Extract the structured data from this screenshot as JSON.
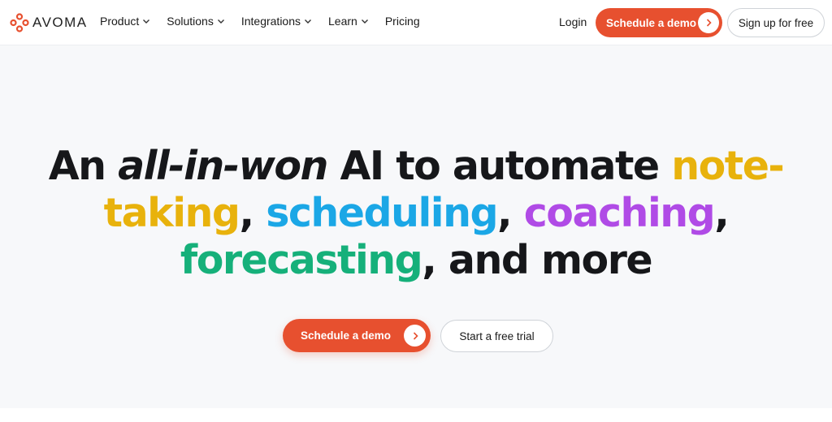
{
  "brand": {
    "name": "AVOMA",
    "accent_color": "#e7502f"
  },
  "nav": {
    "items": [
      {
        "label": "Product",
        "has_dropdown": true
      },
      {
        "label": "Solutions",
        "has_dropdown": true
      },
      {
        "label": "Integrations",
        "has_dropdown": true
      },
      {
        "label": "Learn",
        "has_dropdown": true
      },
      {
        "label": "Pricing",
        "has_dropdown": false
      }
    ],
    "login_label": "Login",
    "demo_label": "Schedule a demo",
    "signup_label": "Sign up for free"
  },
  "hero": {
    "part1": "An ",
    "part2": "all-in-won",
    "part3": " AI to automate ",
    "part4": "note-",
    "part5": "taking",
    "part6": ", ",
    "part7": "scheduling",
    "part8": ", ",
    "part9": "coaching",
    "part10": ",",
    "part11": "forecasting",
    "part12": ", and more",
    "colors": {
      "note_taking": "#e8b20c",
      "scheduling": "#1ba7e6",
      "coaching": "#b04be6",
      "forecasting": "#16b07a"
    },
    "demo_label": "Schedule a demo",
    "trial_label": "Start a free trial"
  }
}
